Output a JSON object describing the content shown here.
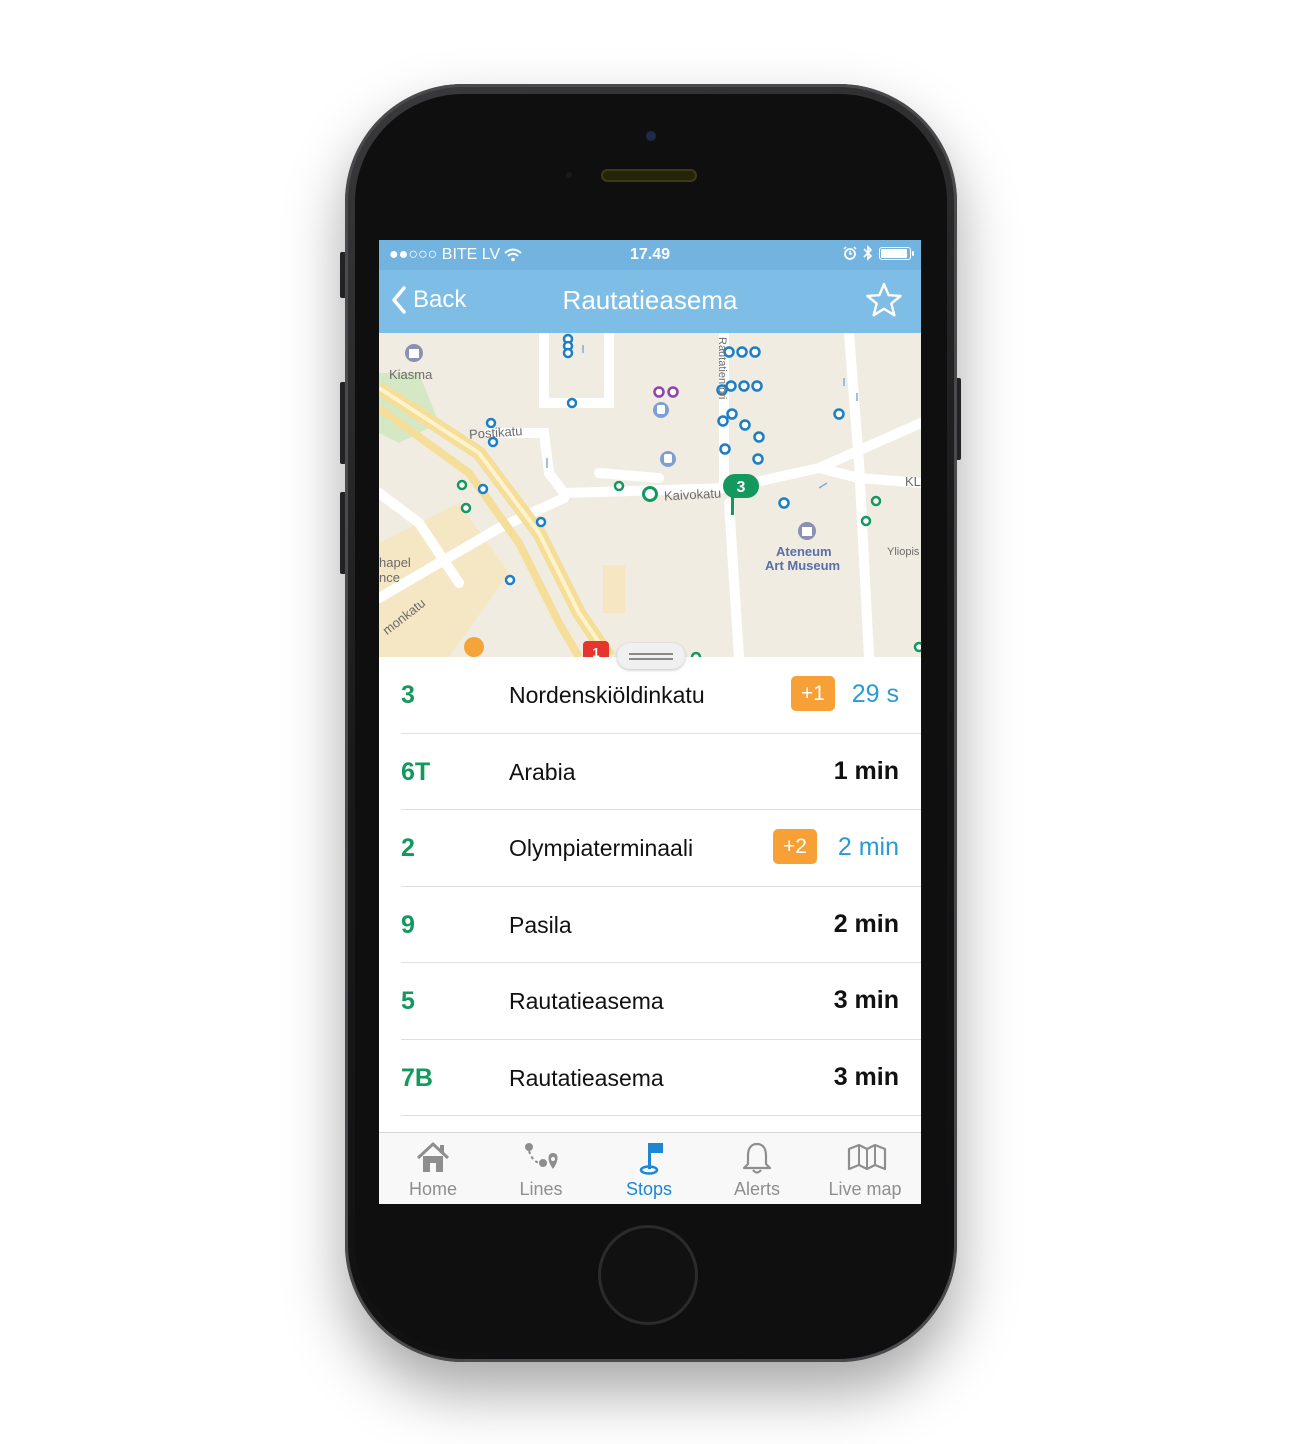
{
  "status_bar": {
    "carrier": "●●○○○ BITE LV",
    "time": "17.49"
  },
  "nav": {
    "back_label": "Back",
    "title": "Rautatieasema",
    "favorite_icon": "star-outline-icon"
  },
  "map": {
    "labels": {
      "kiasma": "Kiasma",
      "postikatu": "Postikatu",
      "kaivokatu": "Kaivokatu",
      "ateneum_line1": "Ateneum",
      "ateneum_line2": "Art Museum",
      "chapel_line1": "hapel",
      "chapel_line2": "nce",
      "monkatu": "monkatu",
      "yliopis": "Yliopis",
      "kl": "KL",
      "rautatientori": "Rautatientori"
    },
    "selected_marker": "3",
    "metro_marker": "1"
  },
  "departures": [
    {
      "route": "3",
      "destination": "Nordenskiöldinkatu",
      "badge": "+1",
      "time": "29 s",
      "live": true
    },
    {
      "route": "6T",
      "destination": "Arabia",
      "badge": "",
      "time": "1 min",
      "live": false
    },
    {
      "route": "2",
      "destination": "Olympiaterminaali",
      "badge": "+2",
      "time": "2 min",
      "live": true
    },
    {
      "route": "9",
      "destination": "Pasila",
      "badge": "",
      "time": "2 min",
      "live": false
    },
    {
      "route": "5",
      "destination": "Rautatieasema",
      "badge": "",
      "time": "3 min",
      "live": false
    },
    {
      "route": "7B",
      "destination": "Rautatieasema",
      "badge": "",
      "time": "3 min",
      "live": false
    }
  ],
  "tabs": [
    {
      "label": "Home",
      "icon": "home-icon",
      "active": false
    },
    {
      "label": "Lines",
      "icon": "lines-icon",
      "active": false
    },
    {
      "label": "Stops",
      "icon": "stop-flag-icon",
      "active": true
    },
    {
      "label": "Alerts",
      "icon": "bell-icon",
      "active": false
    },
    {
      "label": "Live map",
      "icon": "map-icon",
      "active": false
    }
  ],
  "colors": {
    "header": "#7dbde6",
    "route": "#13985e",
    "live_time": "#2a9ad6",
    "badge": "#f7a035",
    "active_tab": "#1e86d4"
  }
}
